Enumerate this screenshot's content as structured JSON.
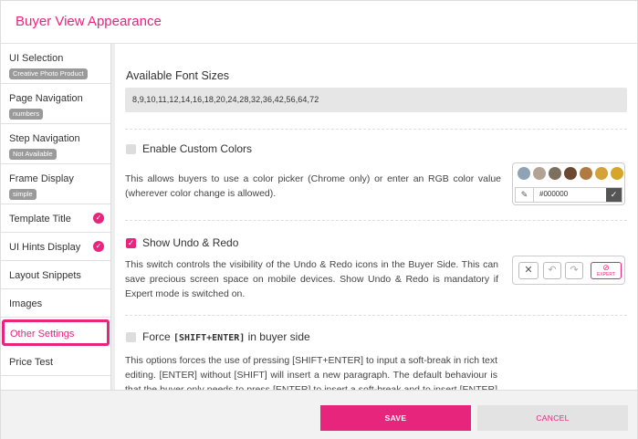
{
  "header": {
    "title": "Buyer View Appearance"
  },
  "sidebar": {
    "items": [
      {
        "label": "UI Selection",
        "badge": "Creative Photo Product"
      },
      {
        "label": "Page Navigation",
        "badge": "numbers"
      },
      {
        "label": "Step Navigation",
        "badge": "Not Available"
      },
      {
        "label": "Frame Display",
        "badge": "simple"
      },
      {
        "label": "Template Title",
        "checked": true
      },
      {
        "label": "UI Hints Display",
        "checked": true
      },
      {
        "label": "Layout Snippets"
      },
      {
        "label": "Images"
      },
      {
        "label": "Other Settings",
        "active": true
      },
      {
        "label": "Price Test"
      }
    ]
  },
  "main": {
    "font_sizes": {
      "title": "Available Font Sizes",
      "value": "8,9,10,11,12,14,16,18,20,24,28,32,36,42,56,64,72"
    },
    "custom_colors": {
      "label": "Enable Custom Colors",
      "checked": false,
      "description": "This allows buyers to use a color picker (Chrome only) or enter an RGB color value (wherever color change is allowed).",
      "swatches": [
        "#8fa3b4",
        "#b2a394",
        "#7d7060",
        "#6b4930",
        "#b07a40",
        "#d3a23a",
        "#d6a62b"
      ],
      "input_value": "#000000"
    },
    "undo_redo": {
      "label": "Show Undo & Redo",
      "checked": true,
      "description": "This switch controls the visibility of the Undo & Redo icons in the Buyer Side. This can save precious screen space on mobile devices. Show Undo & Redo is mandatory if Expert mode is switched on.",
      "expert_label": "EXPERT"
    },
    "shift_enter": {
      "label_prefix": "Force ",
      "label_code": "[SHIFT+ENTER]",
      "label_suffix": " in buyer side",
      "checked": false,
      "description": "This options forces the use of pressing [SHIFT+ENTER] to input a soft-break in rich text editing. [ENTER] without [SHIFT] will insert a new paragraph. The default behaviour is that the buyer only needs to press [ENTER] to insert a soft-break and to insert [ENTER] to"
    }
  },
  "footer": {
    "save_label": "SAVE",
    "cancel_label": "CANCEL"
  },
  "colors": {
    "accent": "#e8257d"
  }
}
